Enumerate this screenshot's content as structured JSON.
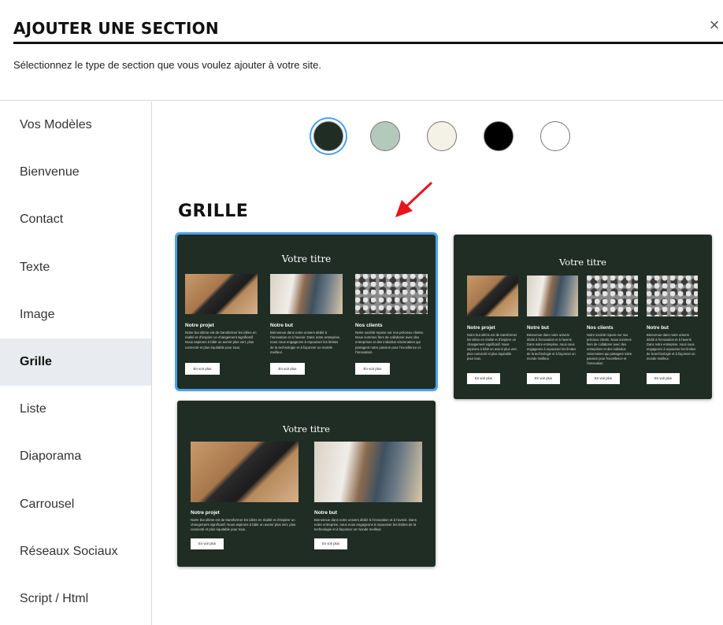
{
  "header": {
    "title": "AJOUTER UNE SECTION",
    "subtitle": "Sélectionnez le type de section que vous voulez ajouter à votre site.",
    "close_icon": "×"
  },
  "sidebar": {
    "items": [
      {
        "label": "Vos Modèles"
      },
      {
        "label": "Bienvenue"
      },
      {
        "label": "Contact"
      },
      {
        "label": "Texte"
      },
      {
        "label": "Image"
      },
      {
        "label": "Grille",
        "active": true
      },
      {
        "label": "Liste"
      },
      {
        "label": "Diaporama"
      },
      {
        "label": "Carrousel"
      },
      {
        "label": "Réseaux Sociaux"
      },
      {
        "label": "Script / Html"
      }
    ]
  },
  "color_swatches": [
    {
      "color": "#1f2d25",
      "selected": true
    },
    {
      "color": "#b3c9bc",
      "selected": false
    },
    {
      "color": "#f4f1e6",
      "selected": false
    },
    {
      "color": "#000000",
      "selected": false
    },
    {
      "color": "#ffffff",
      "selected": false
    }
  ],
  "section_title": "GRILLE",
  "cards": [
    {
      "title": "Votre titre",
      "columns": [
        {
          "heading": "Notre projet",
          "text": "Notre but ultime est de transformer les idées en réalité et d'inspirer un changement significatif. Nous aspirons à bâtir un avenir plus vert, plus connecté et plus équitable pour tous.",
          "button": "En voir plus",
          "image": "desk-phone-image"
        },
        {
          "heading": "Notre but",
          "text": "Bienvenue dans notre univers dédié à l'innovation et à l'avenir. Dans notre entreprise, nous nous engageons à repousser les limites de la technologie et à façonner un monde meilleur.",
          "button": "En voir plus",
          "image": "people-laptop-image"
        },
        {
          "heading": "Nos clients",
          "text": "Notre société repose sur nos précieux clients. Nous sommes fiers de collaborer avec des entreprises et des individus visionnaires qui partagent notre passion pour l'excellence et l'innovation.",
          "button": "En voir plus",
          "image": "texture-image"
        }
      ]
    },
    {
      "title": "Votre titre",
      "columns": [
        {
          "heading": "Notre projet",
          "text": "Notre but ultime est de transformer les idées en réalité et d'inspirer un changement significatif. Nous aspirons à bâtir un avenir plus vert, plus connecté et plus équitable pour tous.",
          "button": "En voir plus",
          "image": "desk-phone-image"
        },
        {
          "heading": "Notre but",
          "text": "Bienvenue dans notre univers dédié à l'innovation et à l'avenir. Dans notre entreprise, nous nous engageons à repousser les limites de la technologie et à façonner un monde meilleur.",
          "button": "En voir plus",
          "image": "people-laptop-image"
        },
        {
          "heading": "Nos clients",
          "text": "Notre société repose sur nos précieux clients. Nous sommes fiers de collaborer avec des entreprises et des individus visionnaires qui partagent notre passion pour l'excellence et l'innovation.",
          "button": "En voir plus",
          "image": "texture-image"
        },
        {
          "heading": "Notre but",
          "text": "Bienvenue dans notre univers dédié à l'innovation et à l'avenir. Dans notre entreprise, nous nous engageons à repousser les limites de la technologie et à façonner un monde meilleur.",
          "button": "En voir plus",
          "image": "texture-image"
        }
      ]
    },
    {
      "title": "Votre titre",
      "columns": [
        {
          "heading": "Notre projet",
          "text": "Notre but ultime est de transformer les idées en réalité et d'inspirer un changement significatif. Nous aspirons à bâtir un avenir plus vert, plus connecté et plus équitable pour tous.",
          "button": "En voir plus",
          "image": "desk-phone-image"
        },
        {
          "heading": "Notre but",
          "text": "Bienvenue dans notre univers dédié à l'innovation et à l'avenir. Dans notre entreprise, nous nous engageons à repousser les limites de la technologie et à façonner un monde meilleur.",
          "button": "En voir plus",
          "image": "people-laptop-image"
        }
      ]
    }
  ]
}
